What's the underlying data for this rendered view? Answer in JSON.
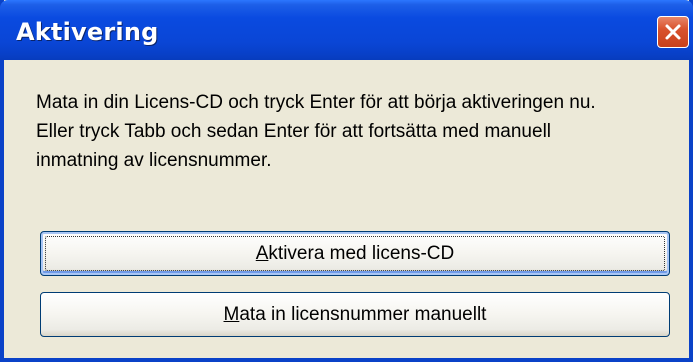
{
  "window": {
    "title": "Aktivering"
  },
  "message": {
    "lines": [
      "Mata in din Licens-CD och tryck Enter för att börja aktiveringen nu.",
      "Eller tryck Tabb och sedan Enter för att fortsätta med manuell",
      "inmatning av licensnummer."
    ]
  },
  "buttons": {
    "activate_cd": {
      "mnemonic": "A",
      "rest": "ktivera med licens-CD"
    },
    "manual_entry": {
      "mnemonic": "M",
      "rest": "ata in licensnummer manuellt"
    }
  },
  "icons": {
    "close": "close-icon"
  },
  "colors": {
    "titlebar": "#0a46d6",
    "close_button": "#d9532e",
    "dialog_background": "#ece9d8",
    "button_border": "#003c74"
  }
}
